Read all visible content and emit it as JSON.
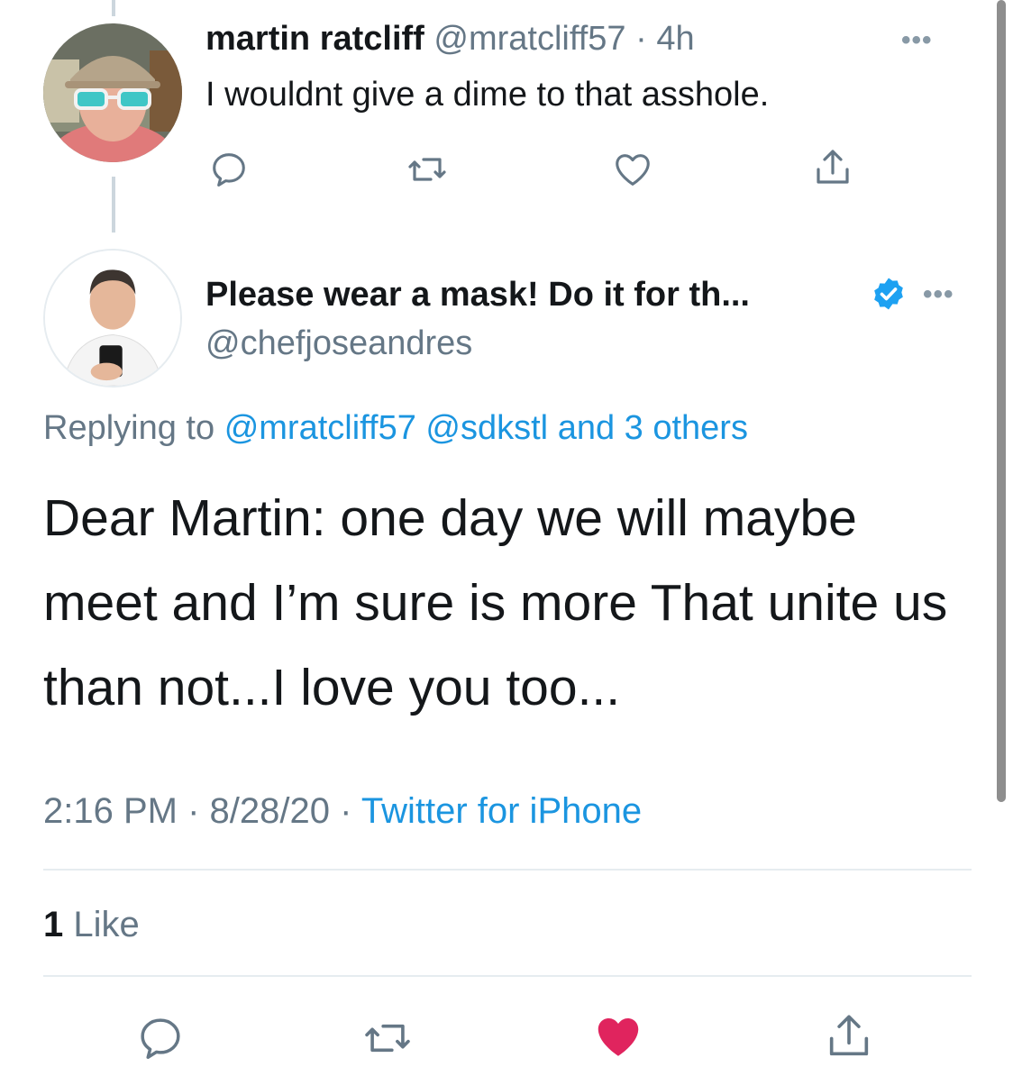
{
  "reply_tweet": {
    "name": "martin ratcliff",
    "handle": "@mratcliff57",
    "separator": "·",
    "time_ago": "4h",
    "text": "I wouldnt give a dime to that asshole.",
    "more_label": "•••"
  },
  "main_tweet": {
    "name": "Please wear a mask! Do it for th...",
    "handle": "@chefjoseandres",
    "more_label": "•••",
    "replying_prefix": "Replying to",
    "replying_mentions": [
      "@mratcliff57",
      "@sdkstl",
      "and 3 others"
    ],
    "text": "Dear Martin: one day we will maybe meet and I’m sure is more That unite us than not...I love you too...",
    "time": "2:16 PM",
    "date": "8/28/20",
    "separator": "·",
    "source": "Twitter for iPhone",
    "like_count": "1",
    "like_label": "Like"
  },
  "icons": {
    "reply": "reply-icon",
    "retweet": "retweet-icon",
    "like": "heart-icon",
    "share": "share-icon",
    "verified": "verified-badge-icon"
  },
  "colors": {
    "text": "#14171a",
    "muted": "#657786",
    "link": "#1b95e0",
    "verified": "#1da1f2",
    "liked_heart": "#e0245e",
    "divider": "#e6ecf0"
  }
}
